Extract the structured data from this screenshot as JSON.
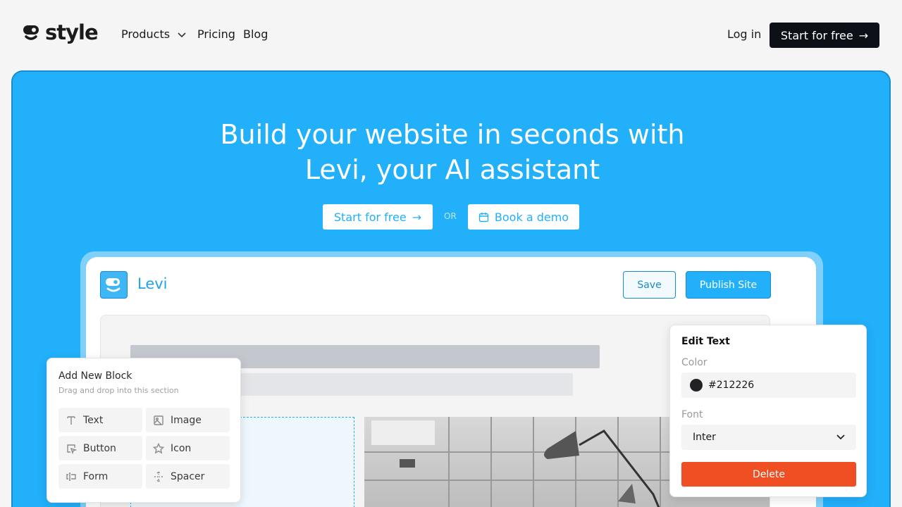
{
  "nav": {
    "brand": "style",
    "products": "Products",
    "pricing": "Pricing",
    "blog": "Blog",
    "login": "Log in",
    "cta": "Start for free"
  },
  "hero": {
    "title_line1": "Build your website in seconds with",
    "title_line2": "Levi, your AI assistant",
    "start": "Start for free",
    "or": "OR",
    "demo": "Book a demo"
  },
  "editor": {
    "name": "Levi",
    "save": "Save",
    "publish": "Publish Site"
  },
  "add_block": {
    "title": "Add New Block",
    "subtitle": "Drag and drop into this section",
    "items": [
      {
        "label": "Text",
        "icon": "text-icon"
      },
      {
        "label": "Image",
        "icon": "image-icon"
      },
      {
        "label": "Button",
        "icon": "button-cursor-icon"
      },
      {
        "label": "Icon",
        "icon": "star-icon"
      },
      {
        "label": "Form",
        "icon": "form-icon"
      },
      {
        "label": "Spacer",
        "icon": "spacer-icon"
      }
    ]
  },
  "edit_text": {
    "title": "Edit Text",
    "color_label": "Color",
    "color_value": "#212226",
    "font_label": "Font",
    "font_value": "Inter",
    "delete": "Delete"
  },
  "colors": {
    "brand_blue": "#22b0fa",
    "dark": "#0d1117",
    "delete": "#f04e23"
  }
}
